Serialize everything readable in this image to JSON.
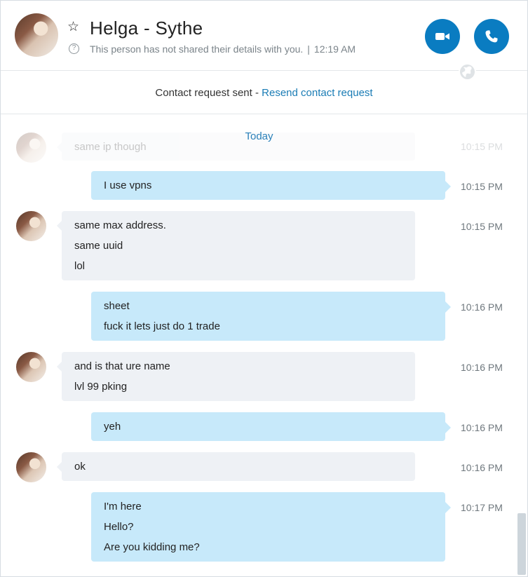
{
  "header": {
    "name": "Helga - Sythe",
    "status_text": "This person has not shared their details with you.",
    "separator": "|",
    "time": "12:19 AM",
    "star_icon": "star-outline-icon",
    "help_icon": "question-circle-icon",
    "help_glyph": "?",
    "video_icon": "video-camera-icon",
    "phone_icon": "phone-icon",
    "globe_icon": "globe-icon",
    "accent_color": "#0a7cc1"
  },
  "request_bar": {
    "text": "Contact request sent - ",
    "link": "Resend contact request"
  },
  "chat": {
    "day_label": "Today",
    "ghost": {
      "text": "same ip though",
      "time": "10:15 PM"
    },
    "messages": [
      {
        "dir": "out",
        "lines": [
          "I use vpns"
        ],
        "time": "10:15 PM"
      },
      {
        "dir": "in",
        "lines": [
          "same max address.",
          "same uuid",
          "lol"
        ],
        "time": "10:15 PM"
      },
      {
        "dir": "out",
        "lines": [
          "sheet",
          "fuck it lets just do 1 trade"
        ],
        "time": "10:16 PM"
      },
      {
        "dir": "in",
        "lines": [
          "and is that ure name",
          "lvl 99 pking"
        ],
        "time": "10:16 PM"
      },
      {
        "dir": "out",
        "lines": [
          "yeh"
        ],
        "time": "10:16 PM"
      },
      {
        "dir": "in",
        "lines": [
          "ok"
        ],
        "time": "10:16 PM"
      },
      {
        "dir": "out",
        "lines": [
          "I'm here",
          "Hello?",
          "Are you kidding me?"
        ],
        "time": "10:17 PM"
      }
    ]
  }
}
